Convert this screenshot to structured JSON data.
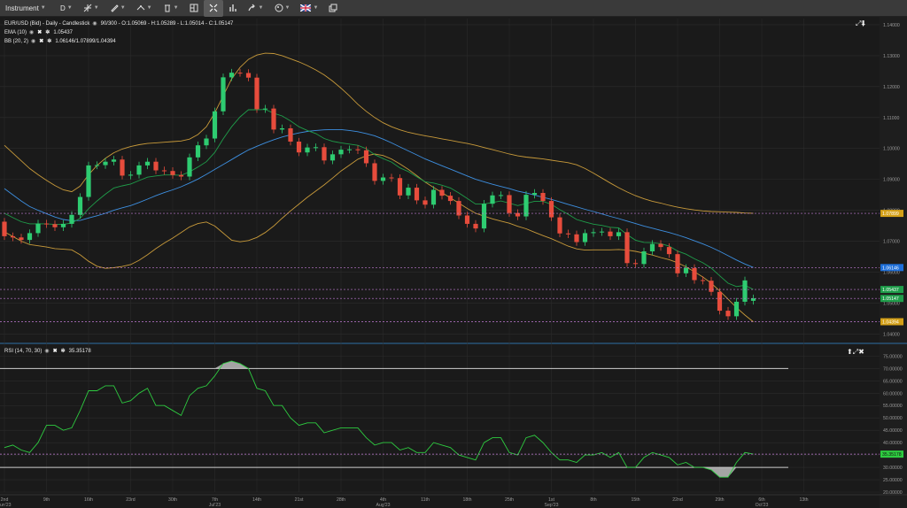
{
  "toolbar": {
    "instrument": "Instrument",
    "timeframe": "D",
    "icons": [
      "crosshair-icon",
      "pencil-icon",
      "shapes-icon",
      "trash-icon",
      "layout-icon",
      "fit-icon",
      "bar-chart-icon",
      "share-icon",
      "palette-icon",
      "flag-uk-icon",
      "window-icon"
    ]
  },
  "legends": {
    "price": "EUR/USD (Bid) - Daily - Candlestick",
    "price_values": "90/300 - O:1.05069 - H:1.05289 - L:1.05014 - C:1.05147",
    "ema": "EMA (10)",
    "ema_value": "1.05437",
    "bb": "BB (20, 2)",
    "bb_value": "1.06146/1.07899/1.04394",
    "rsi": "RSI (14, 70, 30)",
    "rsi_value": "35.35178"
  },
  "price_badges": [
    {
      "label": "1.07899",
      "color": "#d4a017",
      "value": 1.07899
    },
    {
      "label": "1.06146",
      "color": "#1e6fd9",
      "value": 1.06146
    },
    {
      "label": "1.05437",
      "color": "#1f9d4a",
      "value": 1.05437
    },
    {
      "label": "1.05147",
      "color": "#1f9d4a",
      "value": 1.05147
    },
    {
      "label": "1.04394",
      "color": "#d4a017",
      "value": 1.04394
    }
  ],
  "rsi_badge": {
    "label": "35.35178",
    "color": "#2ecc40",
    "value": 35.35178
  },
  "colors": {
    "bg": "#1a1a1a",
    "grid": "#2c2c2c",
    "up": "#2ecc71",
    "down": "#e74c3c",
    "ema": "#1f9d4a",
    "bb_mid": "#3d8fe0",
    "bb_band": "#c89a3a",
    "rsi": "#2ecc40",
    "axis_text": "#9a9a9a"
  },
  "chart_data": [
    {
      "type": "candlestick",
      "title": "EUR/USD (Bid) - Daily - Candlestick",
      "y_ticks": [
        "1.14000",
        "1.13000",
        "1.12000",
        "1.11000",
        "1.10000",
        "1.09000",
        "1.08000",
        "1.07000",
        "1.06000",
        "1.05000",
        "1.04000"
      ],
      "ylim": [
        1.0375,
        1.142
      ],
      "x_ticks": [
        {
          "label": "2nd",
          "sub": "Jun'23",
          "i": 0
        },
        {
          "label": "9th",
          "sub": "",
          "i": 5
        },
        {
          "label": "16th",
          "sub": "",
          "i": 10
        },
        {
          "label": "23rd",
          "sub": "",
          "i": 15
        },
        {
          "label": "30th",
          "sub": "",
          "i": 20
        },
        {
          "label": "7th",
          "sub": "Jul'23",
          "i": 25
        },
        {
          "label": "14th",
          "sub": "",
          "i": 30
        },
        {
          "label": "21st",
          "sub": "",
          "i": 35
        },
        {
          "label": "28th",
          "sub": "",
          "i": 40
        },
        {
          "label": "4th",
          "sub": "Aug'23",
          "i": 45
        },
        {
          "label": "11th",
          "sub": "",
          "i": 50
        },
        {
          "label": "18th",
          "sub": "",
          "i": 55
        },
        {
          "label": "25th",
          "sub": "",
          "i": 60
        },
        {
          "label": "1st",
          "sub": "Sep'23",
          "i": 65
        },
        {
          "label": "8th",
          "sub": "",
          "i": 70
        },
        {
          "label": "15th",
          "sub": "",
          "i": 75
        },
        {
          "label": "22nd",
          "sub": "",
          "i": 80
        },
        {
          "label": "29th",
          "sub": "",
          "i": 85
        },
        {
          "label": "6th",
          "sub": "Oct'23",
          "i": 90
        },
        {
          "label": "13th",
          "sub": "",
          "i": 95
        }
      ],
      "close": [
        1.0716,
        1.0712,
        1.0704,
        1.0726,
        1.0757,
        1.0755,
        1.0745,
        1.0756,
        1.0785,
        1.0843,
        1.0945,
        1.0946,
        1.0957,
        1.0964,
        1.0912,
        1.0915,
        1.0945,
        1.0957,
        1.0929,
        1.0927,
        1.0914,
        1.0909,
        1.0971,
        1.101,
        1.1032,
        1.112,
        1.123,
        1.1245,
        1.1244,
        1.1229,
        1.1127,
        1.1129,
        1.1061,
        1.1065,
        1.1022,
        1.0987,
        1.1003,
        1.1004,
        1.0961,
        1.0981,
        1.0996,
        1.0997,
        1.0994,
        1.0952,
        1.0895,
        1.0906,
        1.0904,
        1.0848,
        1.0873,
        1.0832,
        1.0818,
        1.0866,
        1.0847,
        1.083,
        1.0783,
        1.0756,
        1.0741,
        1.0821,
        1.0848,
        1.0849,
        1.0791,
        1.078,
        1.085,
        1.0856,
        1.083,
        1.0777,
        1.0725,
        1.0722,
        1.0697,
        1.0726,
        1.0729,
        1.0731,
        1.0716,
        1.0729,
        1.0629,
        1.0626,
        1.0667,
        1.0691,
        1.0681,
        1.0658,
        1.0596,
        1.0613,
        1.0574,
        1.0572,
        1.0536,
        1.0475,
        1.0457,
        1.0504,
        1.0573,
        1.0515
      ],
      "open": [
        1.0763,
        1.0716,
        1.0712,
        1.0704,
        1.0726,
        1.0757,
        1.0755,
        1.0745,
        1.0756,
        1.0785,
        1.0843,
        1.0945,
        1.0946,
        1.0957,
        1.0964,
        1.0912,
        1.0915,
        1.0945,
        1.0957,
        1.0929,
        1.0927,
        1.0914,
        1.0909,
        1.0971,
        1.101,
        1.1032,
        1.112,
        1.123,
        1.1245,
        1.1244,
        1.1229,
        1.1127,
        1.1129,
        1.1061,
        1.1065,
        1.1022,
        1.0987,
        1.1003,
        1.1004,
        1.0961,
        1.0981,
        1.0996,
        1.0997,
        1.0994,
        1.0952,
        1.0895,
        1.0906,
        1.0904,
        1.0848,
        1.0873,
        1.0832,
        1.0818,
        1.0866,
        1.0847,
        1.083,
        1.0783,
        1.0756,
        1.0741,
        1.0821,
        1.0848,
        1.0849,
        1.0791,
        1.078,
        1.085,
        1.0856,
        1.083,
        1.0777,
        1.0725,
        1.0722,
        1.0697,
        1.0726,
        1.0729,
        1.0731,
        1.0716,
        1.0729,
        1.0629,
        1.0626,
        1.0667,
        1.0691,
        1.0681,
        1.0658,
        1.0596,
        1.0613,
        1.0574,
        1.0572,
        1.0536,
        1.0475,
        1.0457,
        1.0504,
        1.0507
      ],
      "ema10": [
        1.079,
        1.0776,
        1.0763,
        1.0756,
        1.0756,
        1.0756,
        1.0754,
        1.0754,
        1.0759,
        1.0774,
        1.0805,
        1.083,
        1.0852,
        1.0872,
        1.0879,
        1.0885,
        1.0896,
        1.0907,
        1.0911,
        1.0914,
        1.0914,
        1.0913,
        1.0924,
        1.094,
        1.0957,
        1.0987,
        1.1031,
        1.107,
        1.1102,
        1.1125,
        1.1125,
        1.1126,
        1.1114,
        1.1105,
        1.1089,
        1.107,
        1.1058,
        1.1048,
        1.1032,
        1.1023,
        1.1018,
        1.1014,
        1.101,
        1.0999,
        1.098,
        1.0967,
        1.0956,
        1.0937,
        1.0925,
        1.0908,
        1.0892,
        1.0888,
        1.0881,
        1.0872,
        1.0856,
        1.0838,
        1.082,
        1.082,
        1.0825,
        1.083,
        1.0823,
        1.0815,
        1.0822,
        1.0829,
        1.0829,
        1.0819,
        1.0802,
        1.0787,
        1.077,
        1.0762,
        1.0755,
        1.0751,
        1.0745,
        1.0743,
        1.0721,
        1.0703,
        1.0696,
        1.0695,
        1.0692,
        1.0684,
        1.0668,
        1.0658,
        1.0643,
        1.063,
        1.0613,
        1.0588,
        1.0564,
        1.0553,
        1.0557,
        1.0544
      ],
      "bb_mid": [
        1.087,
        1.085,
        1.083,
        1.0812,
        1.08,
        1.0789,
        1.0778,
        1.077,
        1.0766,
        1.0767,
        1.0775,
        1.0782,
        1.079,
        1.08,
        1.0808,
        1.0815,
        1.0825,
        1.0836,
        1.0847,
        1.0857,
        1.0866,
        1.0876,
        1.0888,
        1.0901,
        1.0916,
        1.0932,
        1.0948,
        1.0964,
        1.098,
        1.0995,
        1.1007,
        1.1018,
        1.1028,
        1.1037,
        1.1044,
        1.105,
        1.1055,
        1.1058,
        1.106,
        1.1061,
        1.1061,
        1.1058,
        1.1054,
        1.1048,
        1.1041,
        1.103,
        1.1018,
        1.1005,
        1.0992,
        1.0979,
        1.0966,
        1.0955,
        1.0944,
        1.0933,
        1.0922,
        1.0911,
        1.09,
        1.0892,
        1.0884,
        1.0877,
        1.087,
        1.0862,
        1.0856,
        1.0849,
        1.0842,
        1.0835,
        1.0827,
        1.0819,
        1.0811,
        1.0803,
        1.0796,
        1.0788,
        1.078,
        1.0773,
        1.0765,
        1.0757,
        1.0749,
        1.0742,
        1.0735,
        1.0728,
        1.072,
        1.0711,
        1.0701,
        1.0691,
        1.068,
        1.0667,
        1.0653,
        1.0639,
        1.0626,
        1.0615
      ],
      "bb_upper": [
        1.101,
        1.0985,
        1.096,
        1.0935,
        1.0915,
        1.0897,
        1.088,
        1.0866,
        1.086,
        1.0878,
        1.0915,
        1.0945,
        1.0968,
        1.0986,
        1.0998,
        1.1006,
        1.1012,
        1.1016,
        1.1018,
        1.102,
        1.1022,
        1.1024,
        1.103,
        1.1045,
        1.107,
        1.1115,
        1.117,
        1.1225,
        1.1262,
        1.1288,
        1.1302,
        1.1308,
        1.1307,
        1.13,
        1.129,
        1.128,
        1.1268,
        1.1254,
        1.1238,
        1.1218,
        1.1195,
        1.117,
        1.1143,
        1.112,
        1.11,
        1.1083,
        1.107,
        1.106,
        1.1052,
        1.1046,
        1.1041,
        1.1036,
        1.1031,
        1.1026,
        1.1021,
        1.1016,
        1.101,
        1.1003,
        1.0996,
        1.0989,
        1.0982,
        1.0976,
        1.0972,
        1.0969,
        1.0966,
        1.0962,
        1.0958,
        1.0954,
        1.0947,
        1.0935,
        1.092,
        1.0904,
        1.0888,
        1.0873,
        1.0859,
        1.0847,
        1.0837,
        1.0829,
        1.0823,
        1.0816,
        1.081,
        1.0805,
        1.0801,
        1.0798,
        1.0796,
        1.0795,
        1.0794,
        1.0793,
        1.0791,
        1.079
      ],
      "bb_lower": [
        1.073,
        1.0715,
        1.07,
        1.0689,
        1.0685,
        1.0681,
        1.0676,
        1.0674,
        1.0672,
        1.0656,
        1.0635,
        1.0619,
        1.0612,
        1.0614,
        1.0618,
        1.0624,
        1.0638,
        1.0656,
        1.0676,
        1.0694,
        1.071,
        1.0728,
        1.0746,
        1.0757,
        1.0762,
        1.0749,
        1.0726,
        1.0703,
        1.0698,
        1.0702,
        1.0712,
        1.0728,
        1.0749,
        1.0774,
        1.0798,
        1.082,
        1.0842,
        1.0862,
        1.0882,
        1.0904,
        1.0927,
        1.0946,
        1.0965,
        1.0976,
        1.0982,
        1.0977,
        1.0966,
        1.095,
        1.0932,
        1.0912,
        1.0891,
        1.0874,
        1.0857,
        1.084,
        1.0823,
        1.0806,
        1.079,
        1.0781,
        1.0772,
        1.0765,
        1.0758,
        1.0748,
        1.074,
        1.0729,
        1.0718,
        1.0708,
        1.0696,
        1.0684,
        1.0675,
        1.0671,
        1.0672,
        1.0672,
        1.0672,
        1.0673,
        1.0671,
        1.0667,
        1.0661,
        1.0655,
        1.0647,
        1.064,
        1.063,
        1.0617,
        1.0601,
        1.0584,
        1.0564,
        1.0539,
        1.0512,
        1.0485,
        1.0461,
        1.0439
      ],
      "price_lines": [
        1.07899,
        1.06146,
        1.05437,
        1.05147,
        1.04394
      ]
    },
    {
      "type": "line",
      "title": "RSI (14, 70, 30)",
      "y_ticks": [
        "75.00000",
        "70.00000",
        "65.00000",
        "60.00000",
        "55.00000",
        "50.00000",
        "45.00000",
        "40.00000",
        "35.00000",
        "30.00000",
        "25.00000",
        "20.00000"
      ],
      "ylim": [
        20,
        78
      ],
      "levels": [
        70,
        30
      ],
      "rsi": [
        38,
        39,
        37,
        36,
        40,
        47,
        47,
        45,
        46,
        53,
        61,
        61,
        63,
        63,
        56,
        57,
        60,
        62,
        55,
        55,
        53,
        51,
        59,
        62,
        63,
        67,
        72,
        73,
        72,
        70,
        62,
        61,
        55,
        55,
        50,
        47,
        48,
        48,
        44,
        45,
        46,
        46,
        46,
        42,
        39,
        40,
        40,
        37,
        38,
        36,
        36,
        40,
        39,
        38,
        35,
        34,
        33,
        40,
        42,
        42,
        36,
        35,
        42,
        43,
        40,
        36,
        33,
        33,
        32,
        35,
        35,
        36,
        34,
        36,
        30,
        30,
        34,
        36,
        35,
        34,
        31,
        32,
        30,
        30,
        29,
        26,
        26,
        32,
        36,
        35.35
      ]
    }
  ]
}
